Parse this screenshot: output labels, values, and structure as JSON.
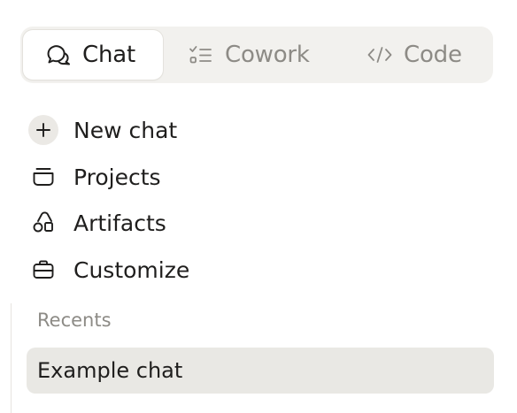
{
  "mode_switcher": {
    "tabs": [
      {
        "label": "Chat",
        "icon": "chat-bubbles-icon",
        "active": true
      },
      {
        "label": "Cowork",
        "icon": "checklist-icon",
        "active": false
      },
      {
        "label": "Code",
        "icon": "code-brackets-icon",
        "active": false
      }
    ]
  },
  "nav": {
    "items": [
      {
        "label": "New chat",
        "icon": "plus-icon"
      },
      {
        "label": "Projects",
        "icon": "folder-icon"
      },
      {
        "label": "Artifacts",
        "icon": "artifacts-shapes-icon"
      },
      {
        "label": "Customize",
        "icon": "briefcase-icon"
      }
    ]
  },
  "recents": {
    "label": "Recents",
    "items": [
      {
        "label": "Example chat",
        "selected": true
      }
    ]
  },
  "colors": {
    "text": "#1f1e1d",
    "muted": "#8d8b86",
    "switcher_bg": "#f2f1ee",
    "selected_bg": "#e9e8e4"
  }
}
